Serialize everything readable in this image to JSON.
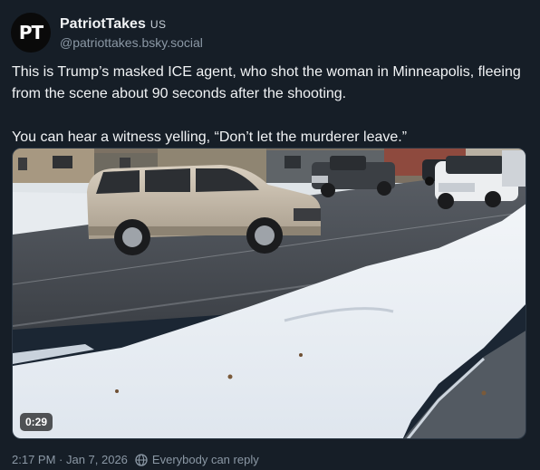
{
  "post": {
    "avatar_text": "PT",
    "display_name": "PatriotTakes",
    "country": "US",
    "handle": "@patriottakes.bsky.social",
    "text_line1": "This is Trump’s masked ICE agent, who shot the woman in Minneapolis, fleeing from the scene about 90 seconds after the shooting.",
    "text_line2": "You can hear a witness yelling, “Don’t let the murderer leave.”",
    "video_duration": "0:29",
    "timestamp": "2:17 PM · Jan 7, 2026",
    "reply_setting": "Everybody can reply"
  },
  "icons": {
    "reply_setting": "globe-icon"
  },
  "colors": {
    "background": "#161e27",
    "text": "#f1f3f5",
    "muted": "#8b98a5"
  }
}
